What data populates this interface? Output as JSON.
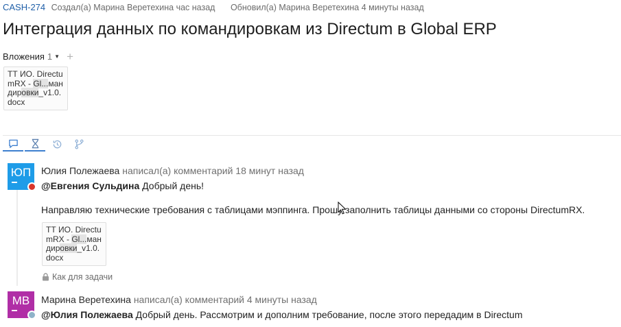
{
  "issue": {
    "key": "CASH-274",
    "created": "Создал(а) Марина Веретехина час назад",
    "updated": "Обновил(а) Марина Веретехина 4 минуты назад",
    "title": "Интеграция данных по командировкам из Directum в Global ERP"
  },
  "attachments": {
    "label": "Вложения",
    "count": "1",
    "file_lines": [
      "ТТ ИО. Directu",
      "mRX - Gl...ман",
      "дировки_v1.0.",
      "docx"
    ]
  },
  "tabs": [
    "comments",
    "history",
    "worklog",
    "development"
  ],
  "comments": [
    {
      "initials": "ЮП",
      "avatar_color": "#1e9ce8",
      "badge_color": "#d9352b",
      "author": "Юлия Полежаева",
      "action": "написал(а) комментарий 18 минут назад",
      "mention": "@Евгения Сульдина",
      "greeting": " Добрый день!",
      "body": "Направляю технические требования с таблицами мэппинга. Прошу заполнить таблицы данными со стороны DirectumRX.",
      "file_lines": [
        "ТТ ИО. Directu",
        "mRX - Gl...ман",
        "дировки_v1.0.",
        "docx"
      ],
      "visibility": "Как для задачи"
    },
    {
      "initials": "МВ",
      "avatar_color": "#b02ea6",
      "badge_color": "#8fb3c9",
      "author": "Марина Веретехина",
      "action": "написал(а) комментарий 4 минуты назад",
      "mention": "@Юлия Полежаева",
      "text": " Добрый день. Рассмотрим и дополним требование, после этого передадим в Directum"
    }
  ],
  "colors": {
    "link": "#1f5fa8",
    "tab_active": "#3d7fcf",
    "tab_icon": "#8fb0d6"
  }
}
